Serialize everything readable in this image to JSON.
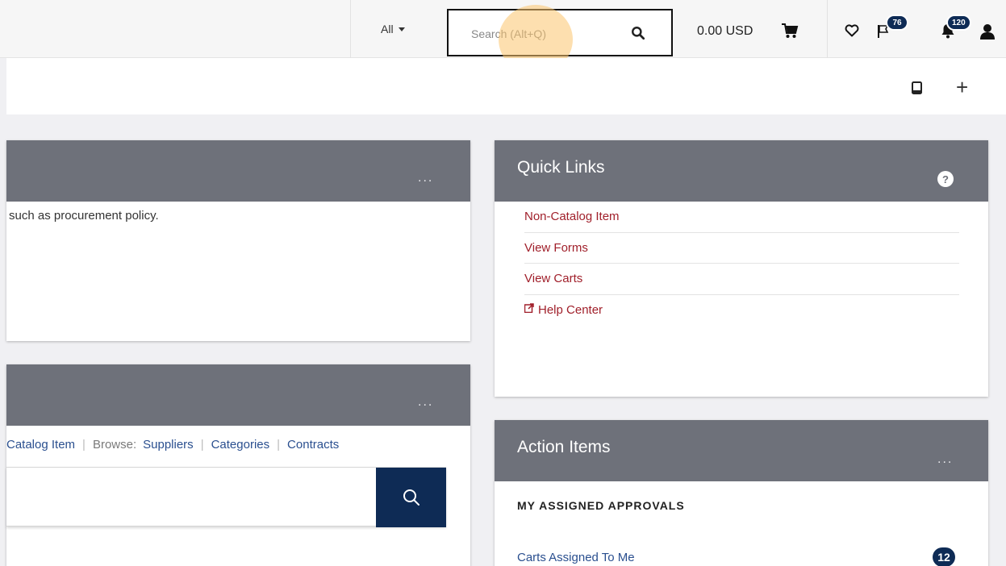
{
  "topbar": {
    "scope_label": "All",
    "search_placeholder": "Search (Alt+Q)",
    "cart_total": "0.00 USD",
    "flag_badge": "76",
    "bell_badge": "120"
  },
  "panel1": {
    "header_title": "",
    "menu_dots": "...",
    "text": "such as procurement policy."
  },
  "panel2": {
    "header_title": "",
    "menu_dots": "...",
    "link_catalog": "Catalog Item",
    "browse_label": "Browse:",
    "link_suppliers": "Suppliers",
    "link_categories": "Categories",
    "link_contracts": "Contracts"
  },
  "quick_links": {
    "title": "Quick Links",
    "help_glyph": "?",
    "items": [
      "Non-Catalog Item",
      "View Forms",
      "View Carts",
      "Help Center"
    ]
  },
  "action_items": {
    "title": "Action Items",
    "menu_dots": "...",
    "section_title": "MY ASSIGNED APPROVALS",
    "row_label": "Carts Assigned To Me",
    "row_count": "12"
  },
  "colors": {
    "header_gray": "#6e717a",
    "navy": "#0e2b55",
    "link_red": "#a01f2a",
    "link_blue": "#2a4f8f"
  }
}
